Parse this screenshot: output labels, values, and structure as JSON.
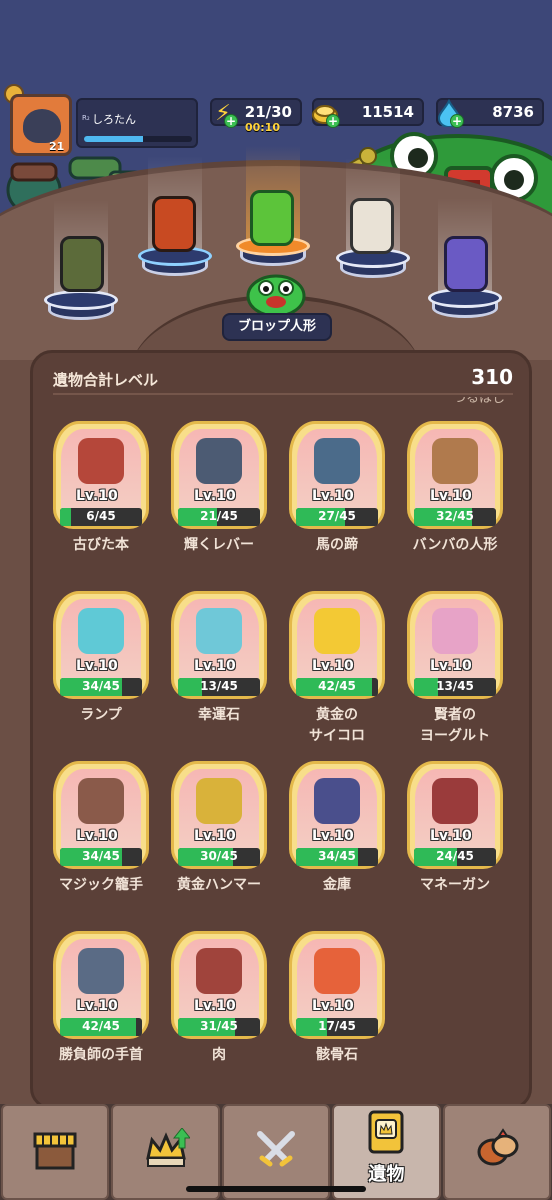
{
  "profile": {
    "rank": "R₂",
    "name": "しろたん",
    "level": "21",
    "xp_fraction": 0.55
  },
  "resources": {
    "energy": "21/30",
    "energy_timer": "00:10",
    "coins": "11514",
    "gems": "8736"
  },
  "scene": {
    "selected_doll": "ブロップ人形"
  },
  "panel": {
    "total_level_label": "遺物合計レベル",
    "total_level_value": "310",
    "cutoff_text": "つるはし"
  },
  "relics": [
    {
      "name": "古びた本",
      "level": "Lv.10",
      "progress": "6/45",
      "fraction": 0.133,
      "color": "#b5473a"
    },
    {
      "name": "輝くレバー",
      "level": "Lv.10",
      "progress": "21/45",
      "fraction": 0.467,
      "color": "#4c5b73"
    },
    {
      "name": "馬の蹄",
      "level": "Lv.10",
      "progress": "27/45",
      "fraction": 0.6,
      "color": "#4b6b8a"
    },
    {
      "name": "バンバの人形",
      "level": "Lv.10",
      "progress": "32/45",
      "fraction": 0.711,
      "color": "#b07a4d"
    },
    {
      "name": "ランプ",
      "level": "Lv.10",
      "progress": "34/45",
      "fraction": 0.756,
      "color": "#5fc9d6"
    },
    {
      "name": "幸運石",
      "level": "Lv.10",
      "progress": "13/45",
      "fraction": 0.289,
      "color": "#6fc8d8"
    },
    {
      "name": "黄金の\nサイコロ",
      "level": "Lv.10",
      "progress": "42/45",
      "fraction": 0.933,
      "color": "#f3c934"
    },
    {
      "name": "賢者の\nヨーグルト",
      "level": "Lv.10",
      "progress": "13/45",
      "fraction": 0.289,
      "color": "#e7a3c7"
    },
    {
      "name": "マジック籠手",
      "level": "Lv.10",
      "progress": "34/45",
      "fraction": 0.756,
      "color": "#8a5a4a"
    },
    {
      "name": "黄金ハンマー",
      "level": "Lv.10",
      "progress": "30/45",
      "fraction": 0.667,
      "color": "#d9b23a"
    },
    {
      "name": "金庫",
      "level": "Lv.10",
      "progress": "34/45",
      "fraction": 0.756,
      "color": "#4a4f8c"
    },
    {
      "name": "マネーガン",
      "level": "Lv.10",
      "progress": "24/45",
      "fraction": 0.533,
      "color": "#9a3b3b"
    },
    {
      "name": "勝負師の手首",
      "level": "Lv.10",
      "progress": "42/45",
      "fraction": 0.933,
      "color": "#5a6b85"
    },
    {
      "name": "肉",
      "level": "Lv.10",
      "progress": "31/45",
      "fraction": 0.689,
      "color": "#a0443c"
    },
    {
      "name": "骸骨石",
      "level": "Lv.10",
      "progress": "17/45",
      "fraction": 0.378,
      "color": "#e6623a"
    }
  ],
  "nav": {
    "shop": "",
    "rank": "",
    "battle": "",
    "relics": "遺物",
    "other": ""
  },
  "colors": {
    "progress_green": "#2fba57",
    "card_gold": "#f8de8a",
    "panel_brown": "#5b4038"
  }
}
